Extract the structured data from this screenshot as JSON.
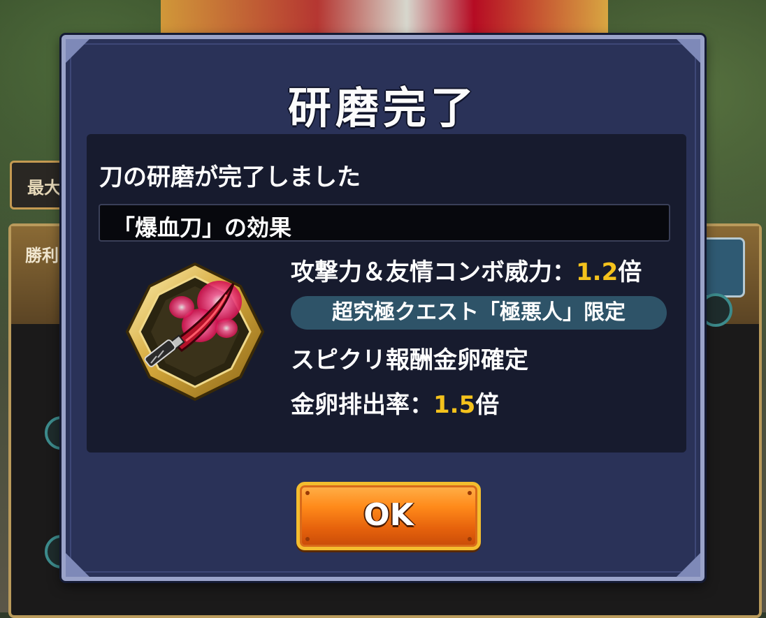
{
  "background": {
    "tab_label": "最大",
    "panel_label": "勝利"
  },
  "dialog": {
    "title": "研磨完了",
    "message": "刀の研磨が完了しました",
    "effect_header": "「爆血刀」の効果",
    "item_icon": "blood-blade-icon",
    "effects": {
      "line1_text": "攻撃力＆友情コンボ威力：",
      "line1_value": "1.2",
      "line1_unit": "倍",
      "restriction": "超究極クエスト「極悪人」限定",
      "line3_text": "スピクリ報酬金卵確定",
      "line4_text": "金卵排出率：",
      "line4_value": "1.5",
      "line4_unit": "倍"
    },
    "ok_label": "OK"
  },
  "colors": {
    "dialog_bg": "#2a3258",
    "content_bg": "#171b2e",
    "highlight_number": "#f4c21c",
    "pill_bg": "#2e5368",
    "ok_button": "#ff8a1a"
  }
}
